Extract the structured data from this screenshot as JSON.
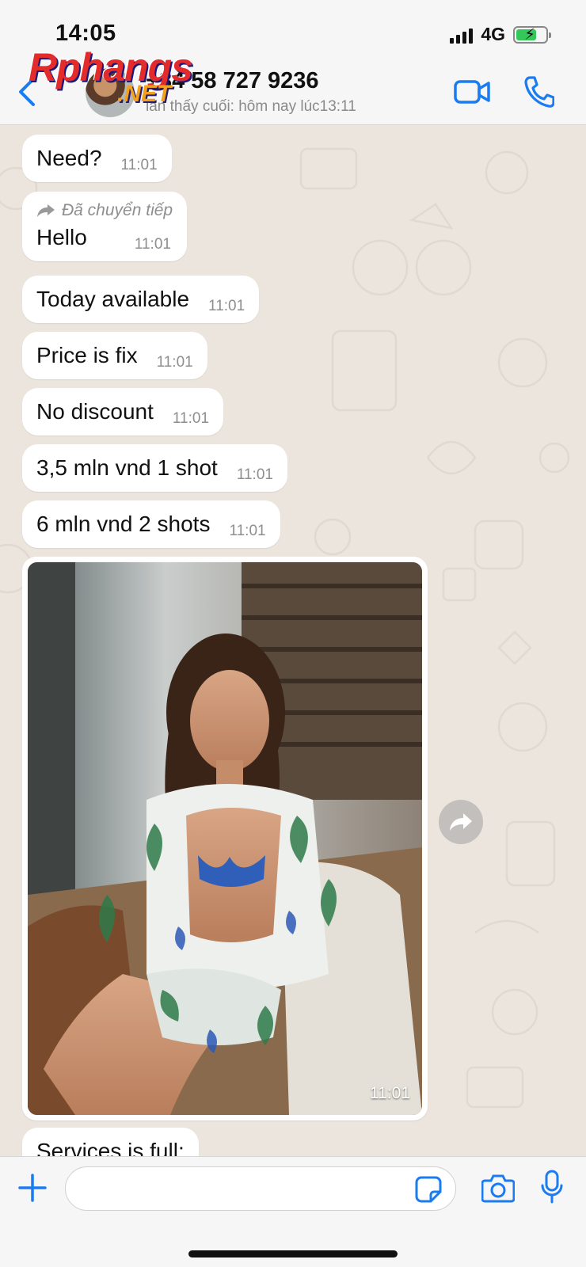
{
  "status_bar": {
    "time": "14:05",
    "network": "4G",
    "battery_level": 0.7,
    "battery_charging": true
  },
  "header": {
    "contact_name": "+84 58 727 9236",
    "last_seen": "lần thấy cuối: hôm nay lúc13:11",
    "icons": [
      "chevron-left-icon",
      "video-camera-icon",
      "phone-icon"
    ]
  },
  "watermark": {
    "line1": "Rphangs",
    "line2": ".NET"
  },
  "messages": [
    {
      "text": "Need?",
      "time": "11:01"
    },
    {
      "forwarded_label": "Đã chuyển tiếp",
      "text": "Hello",
      "time": "11:01"
    },
    {
      "text": "Today available",
      "time": "11:01"
    },
    {
      "text": "Price is fix",
      "time": "11:01"
    },
    {
      "text": "No discount",
      "time": "11:01"
    },
    {
      "text": "3,5 mln vnd 1 shot",
      "time": "11:01"
    },
    {
      "text": "6 mln vnd 2 shots",
      "time": "11:01"
    }
  ],
  "image_message": {
    "time": "11:01"
  },
  "partial_message": {
    "text": "Services is full:"
  },
  "composer": {
    "placeholder": "",
    "icons": [
      "plus-icon",
      "sticker-icon",
      "camera-icon",
      "microphone-icon"
    ]
  },
  "colors": {
    "accent": "#1a7cf0",
    "chat_background": "#ece5dd",
    "bubble": "#ffffff",
    "battery": "#34c759"
  }
}
